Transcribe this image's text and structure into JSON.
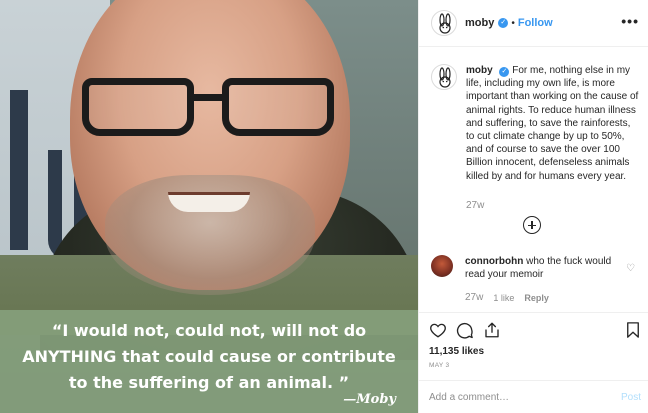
{
  "header": {
    "username": "moby",
    "verified_glyph": "✓",
    "separator": "•",
    "follow_label": "Follow",
    "more_glyph": "•••"
  },
  "image": {
    "quote": "“I would not, could not, will not do ANYTHING that could cause or contribute to the suffering of an animal. ”",
    "quote_lines": [
      "“I would not, could not, will not do",
      "ANYTHING that could cause or contribute",
      "to the suffering of an animal. ”"
    ],
    "signature": "—Moby"
  },
  "caption": {
    "username": "moby",
    "text": "For me, nothing else in my life, including my own life, is more important than working on the cause of animal rights. To reduce human illness and suffering, to save the rainforests, to cut climate change by up to 50%, and of course to save the over 100 Billion innocent, defenseless animals killed by and for humans every year.",
    "time": "27w"
  },
  "comment": {
    "username": "connorbohn",
    "text": "who the fuck would read your memoir",
    "time": "27w",
    "likes": "1 like",
    "reply_label": "Reply",
    "heart_glyph": "♡"
  },
  "actions": {
    "icons": [
      "heart-icon",
      "comment-icon",
      "share-icon",
      "bookmark-icon"
    ]
  },
  "likes_count": "11,135 likes",
  "date": "MAY 3",
  "add_comment": {
    "placeholder": "Add a comment…",
    "post_label": "Post"
  },
  "colors": {
    "link_blue": "#3897f0",
    "post_disabled": "#b2dffc",
    "quote_band": "#86a07c",
    "muted": "#8e8e8e"
  }
}
